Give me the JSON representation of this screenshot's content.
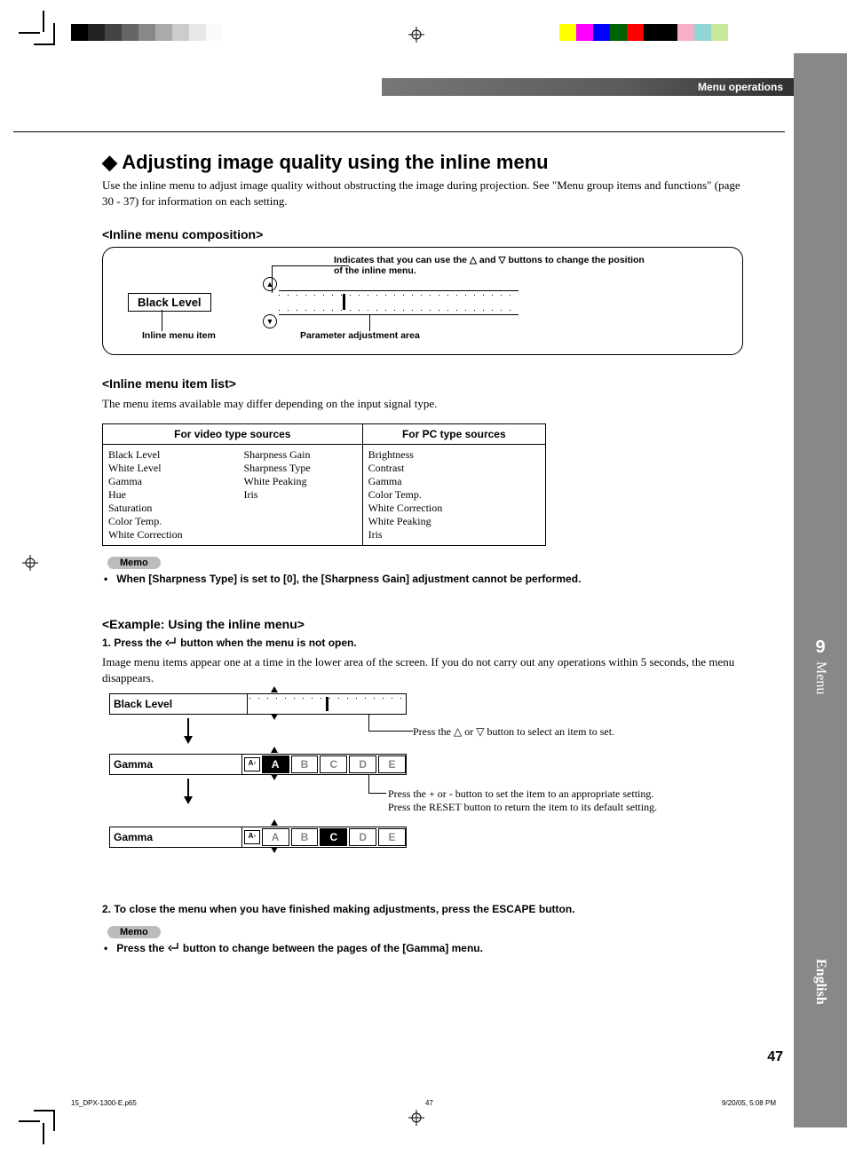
{
  "header": {
    "section": "Menu operations"
  },
  "title": "Adjusting image quality using the inline menu",
  "intro": "Use the inline menu to adjust image quality without obstructing the image during projection. See \"Menu group items and functions\" (page 30 - 37) for information on each setting.",
  "sec1": {
    "h": "<Inline menu composition>",
    "indicates": "Indicates that you can use the △ and ▽ buttons to change the position of the inline menu.",
    "bl": "Black Level",
    "sub1": "Inline menu item",
    "sub2": "Parameter adjustment area"
  },
  "sec2": {
    "h": "<Inline menu item list>",
    "p": "The menu items available may differ depending on the input signal type.",
    "th1": "For video type sources",
    "th2": "For PC type sources",
    "video_a": [
      "Black Level",
      "White Level",
      "Gamma",
      "Hue",
      "Saturation",
      "Color Temp.",
      "White Correction"
    ],
    "video_b": [
      "Sharpness Gain",
      "Sharpness Type",
      "White Peaking",
      "Iris"
    ],
    "pc": [
      "Brightness",
      "Contrast",
      "Gamma",
      "Color Temp.",
      "White Correction",
      "White Peaking",
      "Iris"
    ]
  },
  "memo1": {
    "label": "Memo",
    "text": "When [Sharpness Type] is set to [0], the [Sharpness Gain] adjustment cannot be performed."
  },
  "sec3": {
    "h": "<Example: Using the inline menu>",
    "step1a": "1.   Press the ",
    "step1b": " button when the menu is not open.",
    "p": "Image menu items appear one at a time in the lower area of the screen. If you do not carry out any operations within 5 seconds, the menu disappears.",
    "r1": "Black Level",
    "r2": "Gamma",
    "r3": "Gamma",
    "slots": [
      "A",
      "B",
      "C",
      "D",
      "E"
    ],
    "cap1": "Press the △ or ▽ button to select an item to set.",
    "cap2": "Press the + or - button to set the item to an appropriate setting.\nPress the RESET button to return the item to its default setting.",
    "step2": "2.   To close the menu when you have finished making adjustments, press the ESCAPE button."
  },
  "memo2": {
    "label": "Memo",
    "text_a": "Press the ",
    "text_b": " button to change between the pages of the [Gamma] menu."
  },
  "side": {
    "chapter": "9",
    "chapter_label": "Menu",
    "lang": "English"
  },
  "page": {
    "num": "47"
  },
  "footer": {
    "file": "15_DPX-1300-E.p65",
    "page": "47",
    "date": "9/20/05, 5:08 PM"
  }
}
